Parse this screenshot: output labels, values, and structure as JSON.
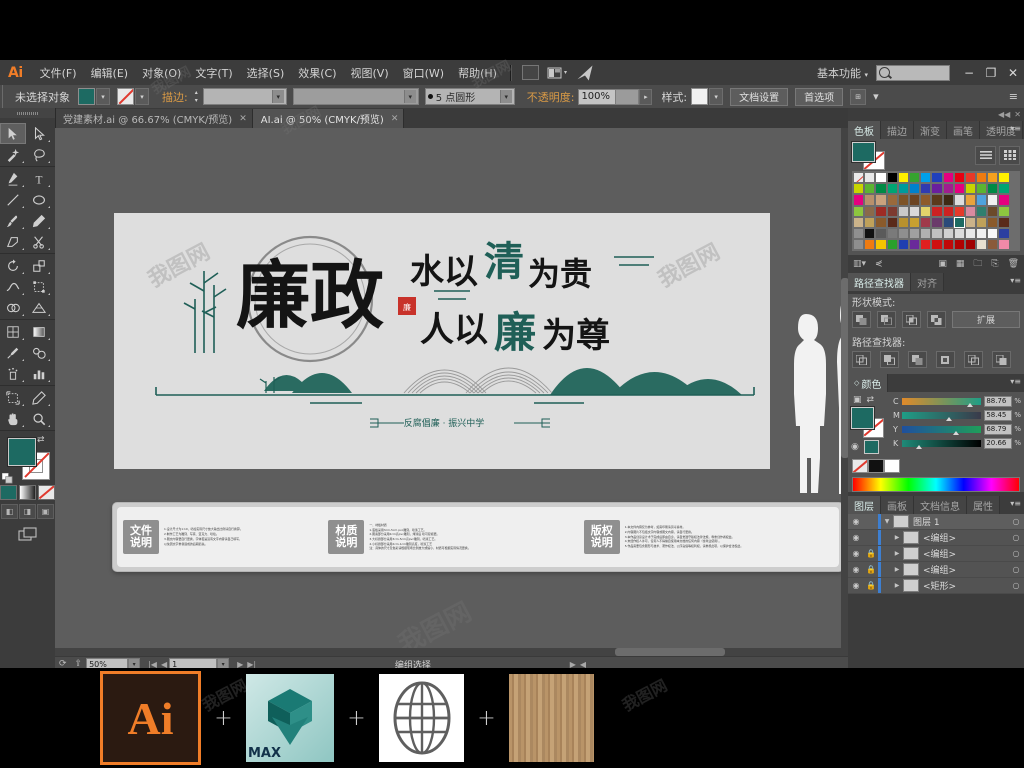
{
  "app": {
    "logo": "Ai",
    "workspace": "基本功能",
    "search_placeholder": ""
  },
  "menubar": {
    "items": [
      "文件(F)",
      "编辑(E)",
      "对象(O)",
      "文字(T)",
      "选择(S)",
      "效果(C)",
      "视图(V)",
      "窗口(W)",
      "帮助(H)"
    ],
    "icons": [
      "bridge-icon",
      "arrange-documents-icon",
      "stock-icon"
    ],
    "window_controls": [
      "−",
      "❐",
      "✕"
    ]
  },
  "controlbar": {
    "selection_status": "未选择对象",
    "stroke_label": "描边:",
    "stroke_weight": "",
    "stroke_profile": "",
    "brush": "5 点圆形",
    "opacity_label": "不透明度:",
    "opacity_value": "100%",
    "style_label": "样式:",
    "doc_setup": "文档设置",
    "preferences": "首选项"
  },
  "tabs": [
    {
      "label": "党建素材.ai @ 66.67% (CMYK/预览)",
      "active": false,
      "close": "✕"
    },
    {
      "label": "AI.ai @ 50% (CMYK/预览)",
      "active": true,
      "close": "✕"
    }
  ],
  "toolbar": {
    "tools": [
      [
        {
          "name": "selection-tool",
          "glyph": "selection",
          "selected": true
        },
        {
          "name": "direct-selection-tool",
          "glyph": "direct"
        }
      ],
      [
        {
          "name": "magic-wand-tool",
          "glyph": "wand"
        },
        {
          "name": "lasso-tool",
          "glyph": "lasso"
        }
      ],
      [
        {
          "name": "pen-tool",
          "glyph": "pen"
        },
        {
          "name": "type-tool",
          "glyph": "T"
        }
      ],
      [
        {
          "name": "line-segment-tool",
          "glyph": "line"
        },
        {
          "name": "ellipse-tool",
          "glyph": "ellipse"
        }
      ],
      [
        {
          "name": "paintbrush-tool",
          "glyph": "brush"
        },
        {
          "name": "pencil-tool",
          "glyph": "pencil"
        }
      ],
      [
        {
          "name": "shaper-tool",
          "glyph": "shaper"
        },
        {
          "name": "scissors-tool",
          "glyph": "scissors"
        }
      ],
      [
        {
          "name": "rotate-tool",
          "glyph": "rotate"
        },
        {
          "name": "scale-tool",
          "glyph": "scale"
        }
      ],
      [
        {
          "name": "width-tool",
          "glyph": "width"
        },
        {
          "name": "free-transform-tool",
          "glyph": "freetrans"
        }
      ],
      [
        {
          "name": "shape-builder-tool",
          "glyph": "builder"
        },
        {
          "name": "perspective-grid-tool",
          "glyph": "perspective"
        }
      ],
      [
        {
          "name": "mesh-tool",
          "glyph": "mesh"
        },
        {
          "name": "gradient-tool",
          "glyph": "gradient"
        }
      ],
      [
        {
          "name": "eyedropper-tool",
          "glyph": "eyedropper"
        },
        {
          "name": "blend-tool",
          "glyph": "blend"
        }
      ],
      [
        {
          "name": "symbol-sprayer-tool",
          "glyph": "symbol"
        },
        {
          "name": "column-graph-tool",
          "glyph": "graph"
        }
      ],
      [
        {
          "name": "artboard-tool",
          "glyph": "artboard"
        },
        {
          "name": "slice-tool",
          "glyph": "slice"
        }
      ],
      [
        {
          "name": "hand-tool",
          "glyph": "hand"
        },
        {
          "name": "zoom-tool",
          "glyph": "zoom"
        }
      ]
    ],
    "fill_color": "#1d6a62",
    "stroke_color": "none",
    "swap_icon": "swap-fill-stroke-icon",
    "default_icon": "default-fill-stroke-icon",
    "color_modes": [
      "color-mode-button",
      "gradient-mode-button",
      "none-mode-button"
    ],
    "draw_modes": [
      "draw-normal-button",
      "draw-behind-button",
      "draw-inside-button"
    ],
    "screen_mode": "screen-mode-button"
  },
  "canvas": {
    "artwork": {
      "main_title": "廉政",
      "line1": "水以清为贵",
      "line2": "人以廉为尊",
      "subtitle": "反腐倡廉 · 振兴中学",
      "seal": "廉政",
      "teal": "#1f5f57"
    },
    "info_panel": {
      "blocks": [
        {
          "label_line1": "文件",
          "label_line2": "说明",
          "lines": [
            "1.设计尺寸为1:10，喷绘实际尺寸放大输出比例请自行换算。",
            "2.制作工艺为雕刻、写真、亚克力、喷绘。",
            "3.图文内容要自行更换，字体若是没有文字内容请自己填写，",
            "   以免因文字重叠造成的后期损失。"
          ]
        },
        {
          "label_line1": "材质",
          "label_line2": "说明",
          "lines": [
            "一、材板材质",
            "1.底板采用3cm-5cm pvc雕刻，喷漆工艺。",
            "2.图案部分采用2cm高pvc雕刻，烤漆后 喷可复模更。",
            "3.大标题部分采用3cm-5cm高pvc雕刻，喷漆工艺。",
            "4.小标题部分采用2cm-1cm雕刻高度，喷漆工艺",
            "注：具体的尺寸及色彩请根据现场比例放大或缩小，材质可根据实际情况更换。"
          ]
        },
        {
          "label_line1": "版权",
          "label_line2": "说明",
          "lines": [
            "1.本文件内容仅为参考，如需印刷请另寻素材。",
            "2.内容图片不包括文字内容或图文内容，请自行更换。",
            "3.本作品创意设计术于完成后即由自身，请自觉遵守版权法律法规，尊重创作者权益。",
            "4.未经作权人许可，任何人不得擅自使用本文档的任何内容（含商业使用）。",
            "5.作品需要包含图形与技术、著作权法、公序良俗等权利权，请重视此项，以保护合法权益。"
          ]
        }
      ]
    }
  },
  "statusbar": {
    "zoom": "50%",
    "page": "1",
    "tool_status": "编组选择"
  },
  "panels": {
    "swatches": {
      "tabs": [
        "色板",
        "描边",
        "渐变",
        "画笔",
        "透明度"
      ],
      "active_tab": "色板",
      "fill_color": "#1d6a62",
      "view_buttons": [
        "list-view-button",
        "grid-view-button"
      ],
      "footer_icons": [
        "swatch-libraries-icon",
        "show-swatch-kinds-icon",
        "swatch-options-icon",
        "new-color-group-icon",
        "new-swatch-icon",
        "delete-swatch-icon"
      ],
      "colors": [
        [
          "none",
          "#e8e8e8",
          "#ffffff",
          "#000000",
          "#ffee00",
          "#36a32f",
          "#00a0e9",
          "#2040bb",
          "#e4007f",
          "#e60012",
          "#e83828",
          "#ef7b10",
          "#f4a01e",
          "#fff000"
        ],
        [
          "#c8d400",
          "#5bb531",
          "#008a45",
          "#00a572",
          "#009b9b",
          "#0081cc",
          "#303bb0",
          "#6a1f9e",
          "#a01e8f",
          "#e4007f"
        ],
        [
          "#e4007f",
          "#b8906b",
          "#caa27d",
          "#9a6a3c",
          "#7d5327",
          "#6b4423",
          "#8e5a2b",
          "#5a3a1c",
          "#3d2a15",
          "#ddd",
          "#e8a33d",
          "#4fa3dd",
          "#f1f1f1"
        ],
        [
          "#8dc63f",
          "#8a6a4a",
          "#9e2b25",
          "#7d3a30",
          "#c9c9c9",
          "#d9d9d9",
          "#e3d36b",
          "#cc2222",
          "#cc2222",
          "#e53a2a",
          "#d98aa0",
          "#2f7f6e",
          "#6b4a2a"
        ],
        [
          "#cbb38a",
          "#bfa15a",
          "#8a5a2b",
          "#5a2a1a",
          "#b8912e",
          "#c8a030",
          "#a03a4a",
          "#6a3a6a",
          "#2a4a7a",
          "#1d6a62"
        ],
        [
          "folder",
          "#111111",
          "#5a5a5a",
          "#7a7a7a",
          "#8f8f8f",
          "#a0a0a0",
          "#b0b0b0",
          "#c0c0c0",
          "#d0d0d0",
          "#dcdcdc",
          "#e8e8e8",
          "#f0f0f0",
          "#f8f8f8",
          "#2b3fa0"
        ],
        [
          "folder",
          "#ef7b10",
          "#f5c400",
          "#2aa02a",
          "#1f3fb0",
          "#6a2a9a",
          "#e02020",
          "#d01010",
          "#c00808",
          "#b00000",
          "#a00000",
          "#e8e0d0",
          "#8a5a3a",
          "#f08aa8"
        ]
      ]
    },
    "pathfinder": {
      "tabs": [
        "路径查找器",
        "对齐"
      ],
      "active_tab": "路径查找器",
      "shape_modes_label": "形状模式:",
      "expand_label": "扩展",
      "pathfinders_label": "路径查找器:",
      "shape_mode_buttons": [
        "unite-button",
        "minus-front-button",
        "intersect-button",
        "exclude-button"
      ],
      "pathfinder_buttons": [
        "divide-button",
        "trim-button",
        "merge-button",
        "crop-button",
        "outline-button",
        "minus-back-button"
      ]
    },
    "color": {
      "title": "颜色",
      "mode": "CMYK",
      "channels": [
        {
          "name": "C",
          "value": "88.76",
          "pct": "%",
          "pos": 82
        },
        {
          "name": "M",
          "value": "58.45",
          "pct": "%",
          "pos": 55
        },
        {
          "name": "Y",
          "value": "68.79",
          "pct": "%",
          "pos": 64
        },
        {
          "name": "K",
          "value": "20.66",
          "pct": "%",
          "pos": 18
        }
      ],
      "fill_color": "#1d6a62"
    },
    "layers": {
      "tabs": [
        "图层",
        "画板",
        "文档信息",
        "属性"
      ],
      "active_tab": "图层",
      "rows": [
        {
          "name": "图层 1",
          "expanded": true,
          "locked": false,
          "visible": true,
          "indent": 0
        },
        {
          "name": "<编组>",
          "expanded": false,
          "locked": false,
          "visible": true,
          "indent": 1
        },
        {
          "name": "<编组>",
          "expanded": false,
          "locked": true,
          "visible": true,
          "indent": 1
        },
        {
          "name": "<编组>",
          "expanded": false,
          "locked": true,
          "visible": true,
          "indent": 1
        },
        {
          "name": "<矩形>",
          "expanded": false,
          "locked": true,
          "visible": true,
          "indent": 1
        }
      ]
    }
  },
  "taskbar": {
    "items": [
      {
        "name": "illustrator-app-icon",
        "label": "Ai"
      },
      {
        "name": "plus-separator",
        "label": "+"
      },
      {
        "name": "3dsmax-app-icon",
        "label": "MAX"
      },
      {
        "name": "plus-separator",
        "label": "+"
      },
      {
        "name": "globe-icon",
        "label": ""
      },
      {
        "name": "plus-separator",
        "label": "+"
      },
      {
        "name": "wood-texture-swatch",
        "label": ""
      }
    ]
  },
  "watermark": "我图网"
}
